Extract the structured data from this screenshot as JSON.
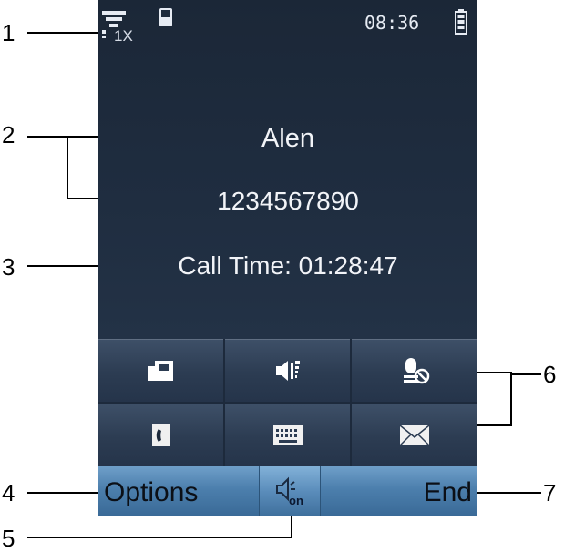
{
  "status_bar": {
    "network": "1X",
    "time": "08:36",
    "icons": [
      "signal-icon",
      "handset-icon",
      "battery-icon"
    ]
  },
  "call": {
    "name": "Alen",
    "number": "1234567890",
    "call_time": "Call Time: 01:28:47"
  },
  "function_buttons": [
    {
      "icon": "transfer-icon"
    },
    {
      "icon": "volume-icon"
    },
    {
      "icon": "mute-icon"
    },
    {
      "icon": "contacts-icon"
    },
    {
      "icon": "keypad-icon"
    },
    {
      "icon": "message-icon"
    }
  ],
  "softkeys": {
    "left": "Options",
    "center_icon": "speaker-on-icon",
    "center_label": "on",
    "right": "End"
  },
  "callouts": [
    "1",
    "2",
    "3",
    "4",
    "5",
    "6",
    "7"
  ],
  "colors": {
    "screen_bg": "#1d2a3c",
    "softkey_bar": "#4c7fad",
    "text": "#f2f4f8"
  }
}
